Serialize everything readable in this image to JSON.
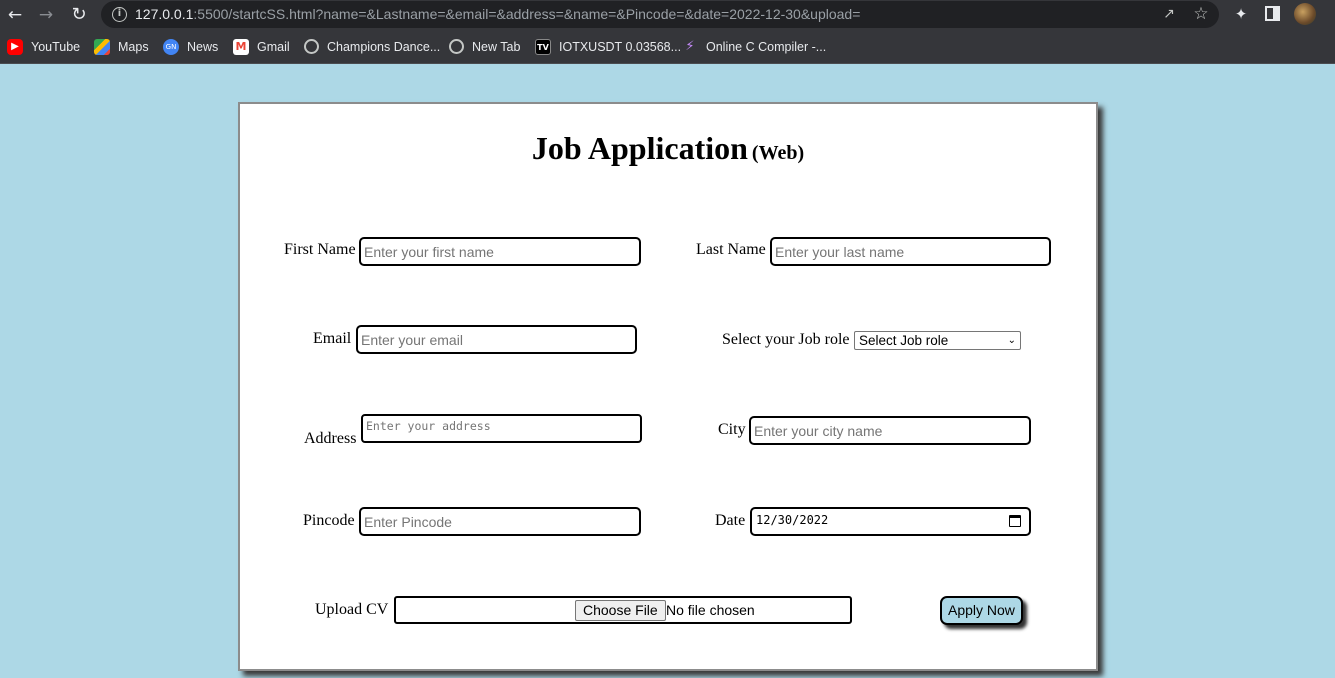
{
  "browser": {
    "url_host": "127.0.0.1",
    "url_rest": ":5500/startcSS.html?name=&Lastname=&email=&address=&name=&Pincode=&date=2022-12-30&upload=",
    "bookmarks": [
      {
        "label": "YouTube",
        "icon": "youtube-icon"
      },
      {
        "label": "Maps",
        "icon": "maps-icon"
      },
      {
        "label": "News",
        "icon": "news-icon"
      },
      {
        "label": "Gmail",
        "icon": "gmail-icon"
      },
      {
        "label": "Champions Dance...",
        "icon": "globe-icon"
      },
      {
        "label": "New Tab",
        "icon": "globe-icon"
      },
      {
        "label": "IOTXUSDT 0.03568...",
        "icon": "tradingview-icon"
      },
      {
        "label": "Online C Compiler -...",
        "icon": "bolt-icon"
      }
    ]
  },
  "form": {
    "title": "Job Application",
    "subtitle": "(Web)",
    "first_name": {
      "label": "First Name",
      "placeholder": "Enter your first name"
    },
    "last_name": {
      "label": "Last Name",
      "placeholder": "Enter your last name"
    },
    "email": {
      "label": "Email",
      "placeholder": "Enter your email"
    },
    "job_role": {
      "label": "Select your Job role",
      "selected": "Select Job role"
    },
    "address": {
      "label": "Address",
      "placeholder": "Enter your address"
    },
    "city": {
      "label": "City",
      "placeholder": "Enter your city name"
    },
    "pincode": {
      "label": "Pincode",
      "placeholder": "Enter Pincode"
    },
    "date": {
      "label": "Date",
      "value": "12/30/2022"
    },
    "upload": {
      "label": "Upload CV",
      "button": "Choose File",
      "status": "No file chosen"
    },
    "submit": "Apply Now"
  },
  "colors": {
    "page_bg": "#add8e6",
    "chrome_bg": "#35363a",
    "card_bg": "#ffffff"
  }
}
